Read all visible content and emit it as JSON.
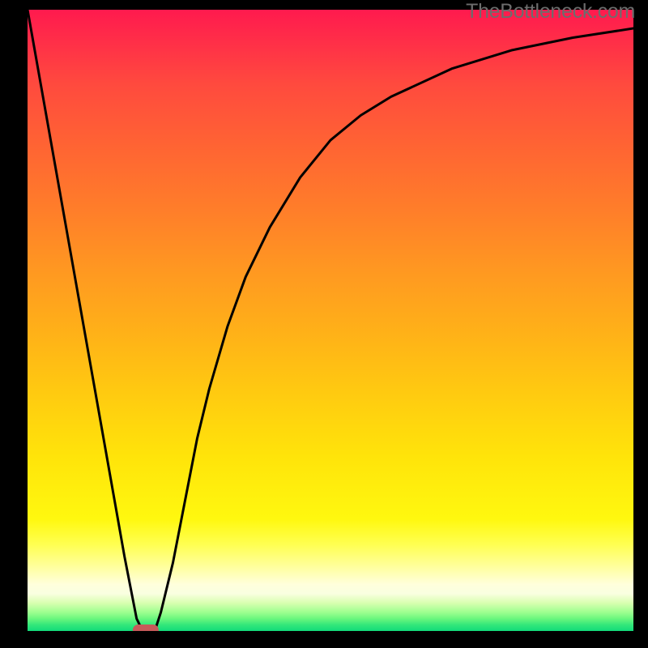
{
  "watermark": "TheBottleneck.com",
  "chart_data": {
    "type": "line",
    "title": "",
    "xlabel": "",
    "ylabel": "",
    "xlim": [
      0,
      100
    ],
    "ylim": [
      0,
      100
    ],
    "series": [
      {
        "name": "bottleneck-curve",
        "x": [
          0,
          2,
          4,
          6,
          8,
          10,
          12,
          14,
          16,
          18,
          19,
          20,
          21,
          22,
          24,
          26,
          28,
          30,
          33,
          36,
          40,
          45,
          50,
          55,
          60,
          70,
          80,
          90,
          100
        ],
        "y": [
          100,
          89,
          78,
          67,
          56,
          45,
          34,
          23,
          12,
          2,
          0,
          0,
          0,
          3,
          11,
          21,
          31,
          39,
          49,
          57,
          65,
          73,
          79,
          83,
          86,
          90.5,
          93.5,
          95.5,
          97
        ]
      }
    ],
    "marker": {
      "x": 19.5,
      "y": 0,
      "color": "#c75a5a"
    },
    "background_gradient": {
      "top_color": "#ff1a4e",
      "mid_color": "#ffe40a",
      "bottom_color": "#12db7a"
    }
  }
}
